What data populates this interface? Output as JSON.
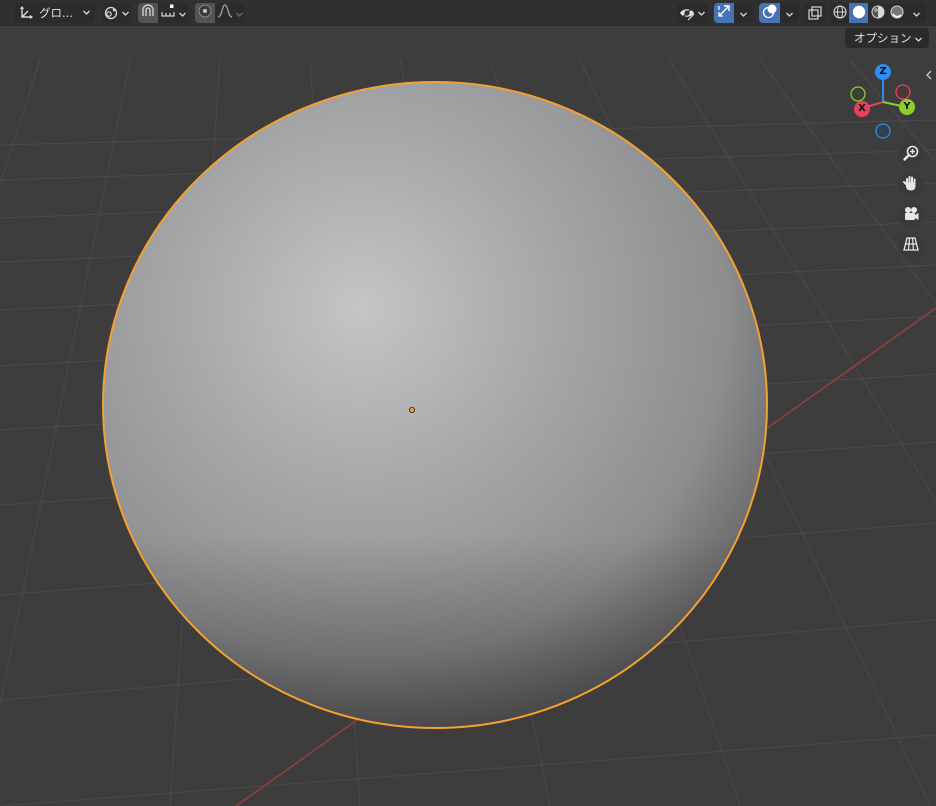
{
  "header": {
    "transform_orientation_label": "グロ...",
    "options_label": "オプション"
  },
  "gizmo": {
    "z_label": "Z",
    "x_label": "X",
    "y_label": "Y"
  },
  "icons": {
    "transform_orientation": "transform-axes-icon",
    "pivot": "pivot-point-icon",
    "snap": "snap-magnet-icon",
    "snap_increment": "snap-increment-icon",
    "proportional_edit": "proportional-edit-icon",
    "falloff": "falloff-curve-icon",
    "visibility": "eye-icon",
    "gizmos": "gizmo-arrow-icon",
    "overlays": "overlays-icon",
    "xray": "xray-icon",
    "wireframe": "wireframe-shading-icon",
    "solid": "solid-shading-icon",
    "material": "material-shading-icon",
    "rendered": "rendered-shading-icon",
    "zoom": "zoom-icon",
    "pan": "hand-icon",
    "camera": "camera-icon",
    "perspective": "perspective-grid-icon"
  },
  "colors": {
    "selection_outline": "#f5a030",
    "axis_x": "#e8405a",
    "axis_y": "#8bd12a",
    "axis_z": "#2f8cf0",
    "active_button": "#4772b3",
    "x_axis_line": "#9a3b3b"
  },
  "viewport": {
    "shading_mode": "solid",
    "selected_object": "sphere"
  }
}
